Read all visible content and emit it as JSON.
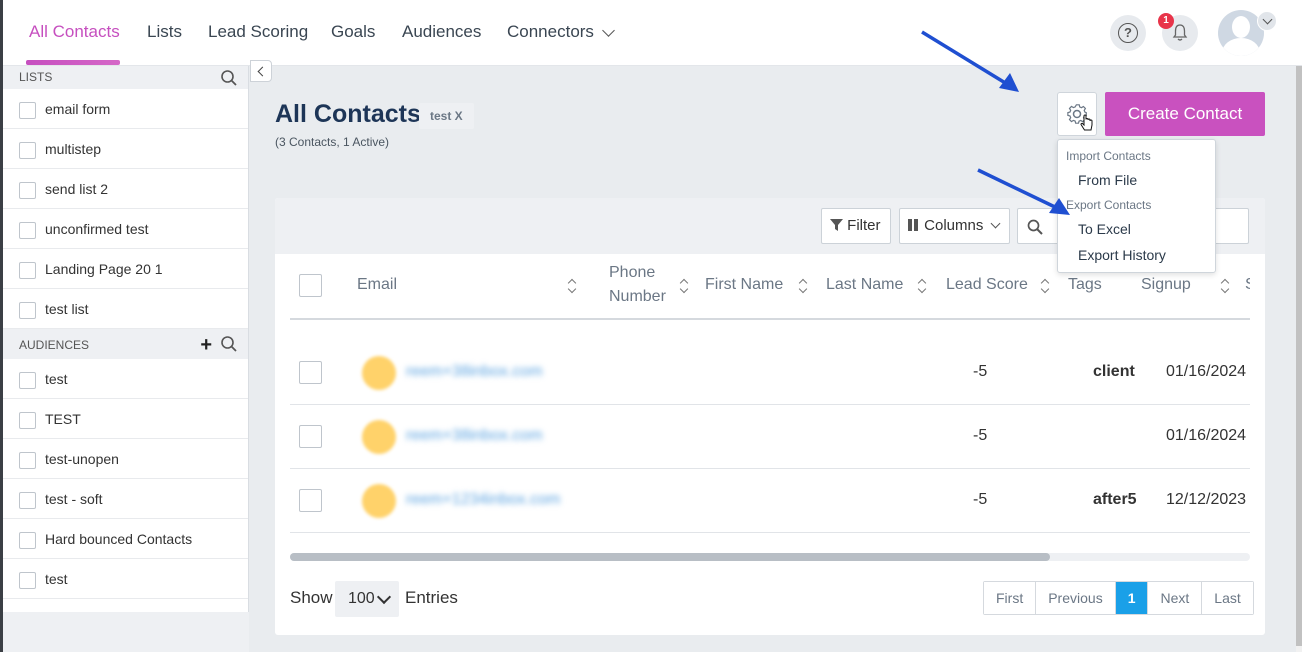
{
  "nav": {
    "items": [
      {
        "label": "All Contacts",
        "active": true
      },
      {
        "label": "Lists"
      },
      {
        "label": "Lead Scoring"
      },
      {
        "label": "Goals"
      },
      {
        "label": "Audiences"
      },
      {
        "label": "Connectors"
      }
    ],
    "notification_count": "1",
    "help_icon": "?"
  },
  "sidebar": {
    "lists_header": "LISTS",
    "lists": [
      "email form",
      "multistep",
      "send list 2",
      "unconfirmed test",
      "Landing Page 20 1",
      "test list"
    ],
    "audiences_header": "AUDIENCES",
    "audiences": [
      "test",
      "TEST",
      "test-unopen",
      "test - soft",
      "Hard bounced Contacts",
      "test"
    ]
  },
  "main": {
    "title": "All Contacts",
    "tag": "test X",
    "subtitle": "(3 Contacts, 1 Active)",
    "create_button": "Create Contact"
  },
  "toolbar": {
    "filter_label": "Filter",
    "columns_label": "Columns"
  },
  "table": {
    "columns": [
      "Email",
      "Phone Number",
      "First Name",
      "Last Name",
      "Lead Score",
      "Tags",
      "Signup",
      "S"
    ],
    "phone_line1": "Phone",
    "phone_line2": "Number",
    "rows": [
      {
        "email": "reem+38inbox.com",
        "lead_score": "-5",
        "tags": "client",
        "signup": "01/16/2024"
      },
      {
        "email": "reem+38inbox.com",
        "lead_score": "-5",
        "tags": "",
        "signup": "01/16/2024"
      },
      {
        "email": "reem+1234inbox.com",
        "lead_score": "-5",
        "tags": "after5",
        "signup": "12/12/2023"
      }
    ]
  },
  "footer": {
    "show_label": "Show",
    "page_size": "100",
    "entries_label": "Entries",
    "pager": {
      "first": "First",
      "previous": "Previous",
      "current": "1",
      "next": "Next",
      "last": "Last"
    }
  },
  "dropdown": {
    "import_header": "Import Contacts",
    "from_file": "From File",
    "export_header": "Export Contacts",
    "to_excel": "To Excel",
    "export_history": "Export History"
  },
  "colors": {
    "accent": "#c951bf",
    "title": "#1d3557",
    "pager_active": "#1aa0e8",
    "arrow": "#1f4fd1"
  }
}
